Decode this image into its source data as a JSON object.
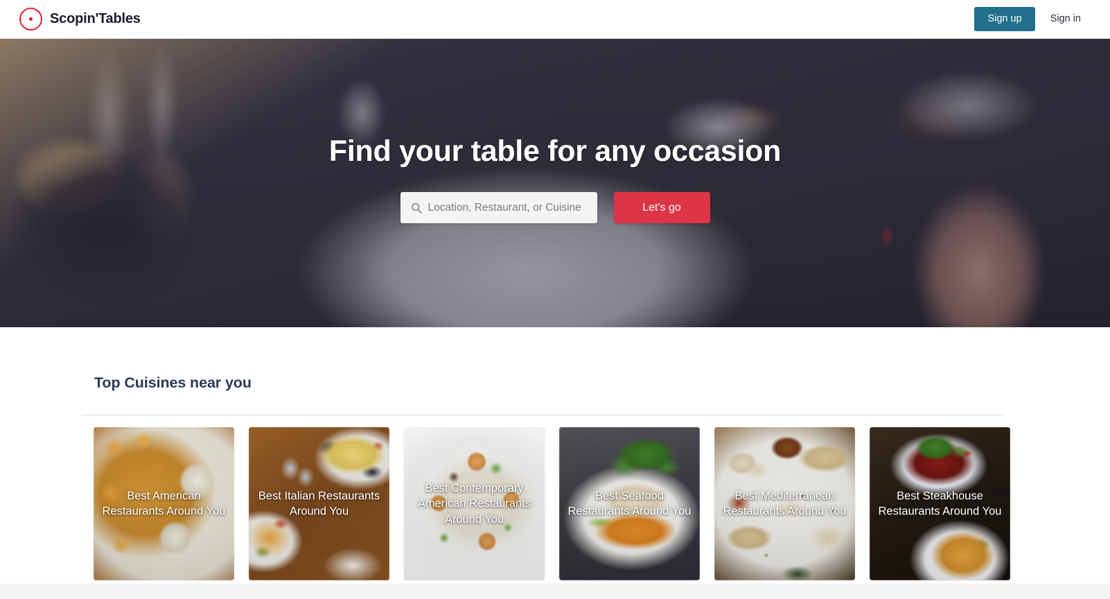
{
  "header": {
    "brand_name": "Scopin'Tables",
    "logo_icon": "target-pin-icon",
    "logo_color": "#e8192c",
    "sign_up_label": "Sign up",
    "sign_up_color": "#22708c",
    "sign_in_label": "Sign in"
  },
  "hero": {
    "title": "Find your table for any occasion",
    "search": {
      "icon": "search-icon",
      "placeholder": "Location, Restaurant, or Cuisine",
      "value": ""
    },
    "cta_label": "Let's go",
    "cta_color": "#dd3545"
  },
  "main": {
    "section_title": "Top Cuisines near you",
    "cards": [
      {
        "label": "Best American Restaurants Around You",
        "cuisine": "American",
        "art": "art-american"
      },
      {
        "label": "Best Italian Restaurants Around You",
        "cuisine": "Italian",
        "art": "art-italian"
      },
      {
        "label": "Best Contemporary American Restaurants Around You",
        "cuisine": "Contemporary American",
        "art": "art-contemporary"
      },
      {
        "label": "Best Seafood Restaurants Around You",
        "cuisine": "Seafood",
        "art": "art-seafood"
      },
      {
        "label": "Best Mediterranean Restaurants Around You",
        "cuisine": "Mediterranean",
        "art": "art-mediterranean"
      },
      {
        "label": "Best Steakhouse Restaurants Around You",
        "cuisine": "Steakhouse",
        "art": "art-steakhouse"
      }
    ]
  }
}
